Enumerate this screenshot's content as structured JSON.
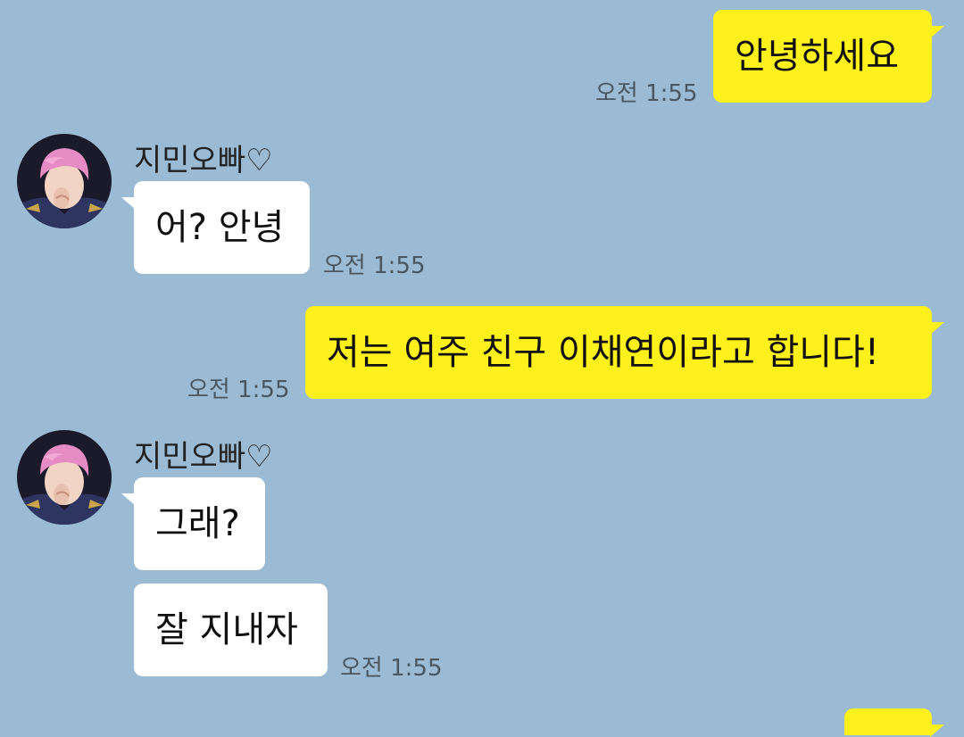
{
  "colors": {
    "background": "#9bbbd4",
    "my_bubble": "#fef01b",
    "friend_bubble": "#ffffff"
  },
  "messages": [
    {
      "text": "안녕하세요",
      "time": "오전 1:55"
    },
    {
      "sender": "지민오빠♡",
      "text": "어? 안녕",
      "time": "오전 1:55"
    },
    {
      "text": "저는 여주 친구 이채연이라고 합니다!",
      "time": "오전 1:55"
    },
    {
      "sender": "지민오빠♡",
      "text": "그래?"
    },
    {
      "text": "잘 지내자",
      "time": "오전 1:55"
    }
  ],
  "avatar_icon": "profile-photo-pink-hair-icon"
}
